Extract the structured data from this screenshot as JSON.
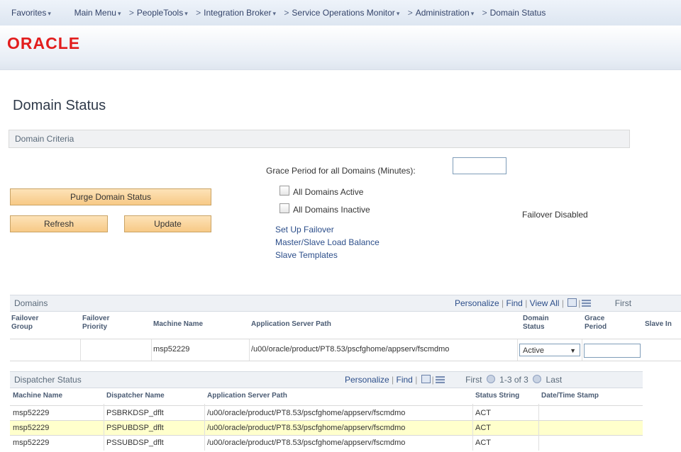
{
  "nav": {
    "favorites": "Favorites",
    "main_menu": "Main Menu",
    "crumbs": [
      "PeopleTools",
      "Integration Broker",
      "Service Operations Monitor",
      "Administration",
      "Domain Status"
    ]
  },
  "brand": {
    "logo_text": "ORACLE",
    "logo_color": "#e21d1d"
  },
  "page_title": "Domain Status",
  "criteria": {
    "section_label": "Domain Criteria",
    "grace_label": "Grace Period for all Domains (Minutes):",
    "grace_value": "",
    "buttons": {
      "purge": "Purge Domain Status",
      "refresh": "Refresh",
      "update": "Update"
    },
    "checkboxes": {
      "all_active": "All Domains Active",
      "all_inactive": "All Domains Inactive"
    },
    "failover_status": "Failover Disabled",
    "links": [
      "Set Up Failover",
      "Master/Slave Load Balance",
      "Slave Templates"
    ]
  },
  "domains_grid": {
    "title": "Domains",
    "tools": {
      "personalize": "Personalize",
      "find": "Find",
      "view_all": "View All",
      "first": "First"
    },
    "headers": [
      "Failover Group",
      "Failover Priority",
      "Machine Name",
      "Application Server Path",
      "Domain Status",
      "Grace Period",
      "Slave In"
    ],
    "row": {
      "machine": "msp52229",
      "path": "/u00/oracle/product/PT8.53/pscfghome/appserv/fscmdmo",
      "status": "Active"
    }
  },
  "dispatcher_grid": {
    "title": "Dispatcher Status",
    "tools": {
      "personalize": "Personalize",
      "find": "Find",
      "first": "First",
      "range": "1-3 of 3",
      "last": "Last"
    },
    "headers": [
      "Machine Name",
      "Dispatcher Name",
      "Application Server Path",
      "Status String",
      "Date/Time Stamp"
    ],
    "rows": [
      {
        "machine": "msp52229",
        "dispatcher": "PSBRKDSP_dflt",
        "path": "/u00/oracle/product/PT8.53/pscfghome/appserv/fscmdmo",
        "status": "ACT"
      },
      {
        "machine": "msp52229",
        "dispatcher": "PSPUBDSP_dflt",
        "path": "/u00/oracle/product/PT8.53/pscfghome/appserv/fscmdmo",
        "status": "ACT"
      },
      {
        "machine": "msp52229",
        "dispatcher": "PSSUBDSP_dflt",
        "path": "/u00/oracle/product/PT8.53/pscfghome/appserv/fscmdmo",
        "status": "ACT"
      }
    ]
  }
}
